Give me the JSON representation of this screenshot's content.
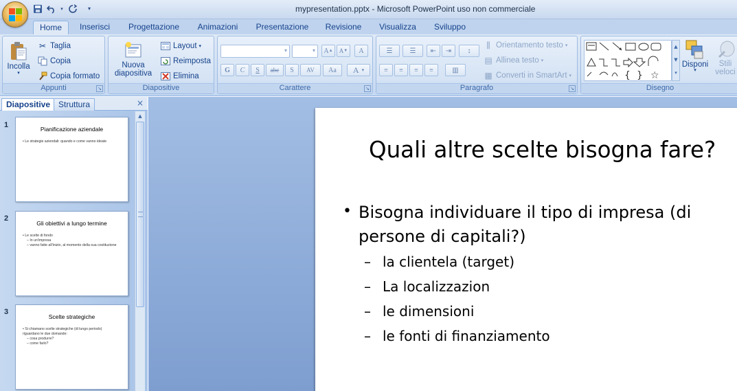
{
  "window": {
    "title": "mypresentation.pptx - Microsoft PowerPoint uso non commerciale",
    "office_logo_colors": [
      "#f25022",
      "#7fba00",
      "#00a4ef",
      "#ffb900"
    ]
  },
  "quick_access": {
    "icons": [
      "save-icon",
      "undo-icon",
      "redo-icon",
      "customize-icon"
    ]
  },
  "tabs": [
    "Home",
    "Inserisci",
    "Progettazione",
    "Animazioni",
    "Presentazione",
    "Revisione",
    "Visualizza",
    "Sviluppo"
  ],
  "ribbon": {
    "appunti": {
      "label": "Appunti",
      "paste": "Incolla",
      "cut": "Taglia",
      "copy": "Copia",
      "format_painter": "Copia formato"
    },
    "diapositive": {
      "label": "Diapositive",
      "new_slide_line1": "Nuova",
      "new_slide_line2": "diapositiva",
      "layout": "Layout",
      "reset": "Reimposta",
      "delete": "Elimina"
    },
    "carattere": {
      "label": "Carattere",
      "font_value": "",
      "size_value": "",
      "grow": "A",
      "shrink": "A",
      "clear": "A",
      "bold": "G",
      "italic": "C",
      "underline": "S",
      "strike": "abc",
      "shadow": "S",
      "spacing": "AV",
      "case": "Aa",
      "color": "A"
    },
    "paragrafo": {
      "label": "Paragrafo",
      "text_direction": "Orientamento testo",
      "align_text": "Allinea testo",
      "smartart": "Converti in SmartArt"
    },
    "disegno": {
      "label": "Disegno",
      "arrange": "Disponi",
      "quick_styles_line1": "Stili",
      "quick_styles_line2": "veloci"
    }
  },
  "left_pane": {
    "tab_slides": "Diapositive",
    "tab_outline": "Struttura",
    "close": "×",
    "thumbnails": [
      {
        "num": "1",
        "title": "Pianificazione aziendale",
        "lines": [
          "• Le strategie aziendali: quando e come vanno ideate"
        ]
      },
      {
        "num": "2",
        "title": "Gli obiettivi a lungo termine",
        "lines": [
          "• Le scelte di fondo",
          "– In un'impresa",
          "– vanno fatte all'inizio, al momento della sua costituzione"
        ]
      },
      {
        "num": "3",
        "title": "Scelte strategiche",
        "lines": [
          "• Si chiamano scelte strategiche (di lungo periodo) riguardano le due domande:",
          "– cosa produrre?",
          "– come farlo?"
        ]
      }
    ]
  },
  "slide": {
    "title": "Quali altre scelte bisogna fare?",
    "bullet_line1": "Bisogna individuare il tipo di impresa (di",
    "bullet_line2": "persone di capitali?)",
    "sub_bullets": [
      "la clientela (target)",
      "La localizzazion",
      "le dimensioni",
      "le fonti di finanziamento"
    ]
  }
}
